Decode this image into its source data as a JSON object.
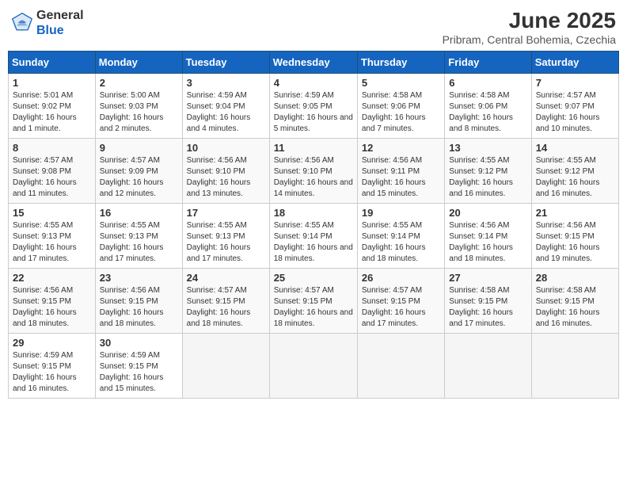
{
  "header": {
    "logo_general": "General",
    "logo_blue": "Blue",
    "month_year": "June 2025",
    "location": "Pribram, Central Bohemia, Czechia"
  },
  "weekdays": [
    "Sunday",
    "Monday",
    "Tuesday",
    "Wednesday",
    "Thursday",
    "Friday",
    "Saturday"
  ],
  "weeks": [
    [
      {
        "day": "1",
        "sunrise": "5:01 AM",
        "sunset": "9:02 PM",
        "daylight": "16 hours and 1 minute."
      },
      {
        "day": "2",
        "sunrise": "5:00 AM",
        "sunset": "9:03 PM",
        "daylight": "16 hours and 2 minutes."
      },
      {
        "day": "3",
        "sunrise": "4:59 AM",
        "sunset": "9:04 PM",
        "daylight": "16 hours and 4 minutes."
      },
      {
        "day": "4",
        "sunrise": "4:59 AM",
        "sunset": "9:05 PM",
        "daylight": "16 hours and 5 minutes."
      },
      {
        "day": "5",
        "sunrise": "4:58 AM",
        "sunset": "9:06 PM",
        "daylight": "16 hours and 7 minutes."
      },
      {
        "day": "6",
        "sunrise": "4:58 AM",
        "sunset": "9:06 PM",
        "daylight": "16 hours and 8 minutes."
      },
      {
        "day": "7",
        "sunrise": "4:57 AM",
        "sunset": "9:07 PM",
        "daylight": "16 hours and 10 minutes."
      }
    ],
    [
      {
        "day": "8",
        "sunrise": "4:57 AM",
        "sunset": "9:08 PM",
        "daylight": "16 hours and 11 minutes."
      },
      {
        "day": "9",
        "sunrise": "4:57 AM",
        "sunset": "9:09 PM",
        "daylight": "16 hours and 12 minutes."
      },
      {
        "day": "10",
        "sunrise": "4:56 AM",
        "sunset": "9:10 PM",
        "daylight": "16 hours and 13 minutes."
      },
      {
        "day": "11",
        "sunrise": "4:56 AM",
        "sunset": "9:10 PM",
        "daylight": "16 hours and 14 minutes."
      },
      {
        "day": "12",
        "sunrise": "4:56 AM",
        "sunset": "9:11 PM",
        "daylight": "16 hours and 15 minutes."
      },
      {
        "day": "13",
        "sunrise": "4:55 AM",
        "sunset": "9:12 PM",
        "daylight": "16 hours and 16 minutes."
      },
      {
        "day": "14",
        "sunrise": "4:55 AM",
        "sunset": "9:12 PM",
        "daylight": "16 hours and 16 minutes."
      }
    ],
    [
      {
        "day": "15",
        "sunrise": "4:55 AM",
        "sunset": "9:13 PM",
        "daylight": "16 hours and 17 minutes."
      },
      {
        "day": "16",
        "sunrise": "4:55 AM",
        "sunset": "9:13 PM",
        "daylight": "16 hours and 17 minutes."
      },
      {
        "day": "17",
        "sunrise": "4:55 AM",
        "sunset": "9:13 PM",
        "daylight": "16 hours and 17 minutes."
      },
      {
        "day": "18",
        "sunrise": "4:55 AM",
        "sunset": "9:14 PM",
        "daylight": "16 hours and 18 minutes."
      },
      {
        "day": "19",
        "sunrise": "4:55 AM",
        "sunset": "9:14 PM",
        "daylight": "16 hours and 18 minutes."
      },
      {
        "day": "20",
        "sunrise": "4:56 AM",
        "sunset": "9:14 PM",
        "daylight": "16 hours and 18 minutes."
      },
      {
        "day": "21",
        "sunrise": "4:56 AM",
        "sunset": "9:15 PM",
        "daylight": "16 hours and 19 minutes."
      }
    ],
    [
      {
        "day": "22",
        "sunrise": "4:56 AM",
        "sunset": "9:15 PM",
        "daylight": "16 hours and 18 minutes."
      },
      {
        "day": "23",
        "sunrise": "4:56 AM",
        "sunset": "9:15 PM",
        "daylight": "16 hours and 18 minutes."
      },
      {
        "day": "24",
        "sunrise": "4:57 AM",
        "sunset": "9:15 PM",
        "daylight": "16 hours and 18 minutes."
      },
      {
        "day": "25",
        "sunrise": "4:57 AM",
        "sunset": "9:15 PM",
        "daylight": "16 hours and 18 minutes."
      },
      {
        "day": "26",
        "sunrise": "4:57 AM",
        "sunset": "9:15 PM",
        "daylight": "16 hours and 17 minutes."
      },
      {
        "day": "27",
        "sunrise": "4:58 AM",
        "sunset": "9:15 PM",
        "daylight": "16 hours and 17 minutes."
      },
      {
        "day": "28",
        "sunrise": "4:58 AM",
        "sunset": "9:15 PM",
        "daylight": "16 hours and 16 minutes."
      }
    ],
    [
      {
        "day": "29",
        "sunrise": "4:59 AM",
        "sunset": "9:15 PM",
        "daylight": "16 hours and 16 minutes."
      },
      {
        "day": "30",
        "sunrise": "4:59 AM",
        "sunset": "9:15 PM",
        "daylight": "16 hours and 15 minutes."
      },
      null,
      null,
      null,
      null,
      null
    ]
  ]
}
